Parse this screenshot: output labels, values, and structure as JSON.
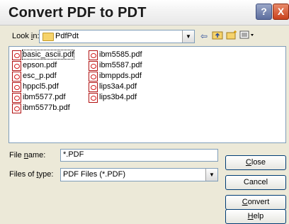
{
  "window": {
    "title": "Convert PDF to PDT"
  },
  "titlebar_buttons": {
    "help": "?",
    "close": "X"
  },
  "lookin": {
    "label_prefix": "Look ",
    "label_u": "i",
    "label_suffix": "n:",
    "value": "PdfPdt"
  },
  "files": {
    "col1": [
      "basic_ascii.pdf",
      "epson.pdf",
      "esc_p.pdf",
      "hppcl5.pdf",
      "ibm5577.pdf",
      "ibm5577b.pdf"
    ],
    "col2": [
      "ibm5585.pdf",
      "ibm5587.pdf",
      "ibmppds.pdf",
      "lips3a4.pdf",
      "lips3b4.pdf"
    ]
  },
  "filename": {
    "label_prefix": "File ",
    "label_u": "n",
    "label_suffix": "ame:",
    "value": "*.PDF"
  },
  "filetype": {
    "label_prefix": "Files of ",
    "label_u": "t",
    "label_suffix": "ype:",
    "value": "PDF Files (*.PDF)"
  },
  "buttons": {
    "close": {
      "u": "C",
      "rest": "lose"
    },
    "cancel": "Cancel",
    "convert": {
      "u": "C",
      "rest": "onvert"
    },
    "help": {
      "u": "H",
      "rest": "elp"
    }
  }
}
